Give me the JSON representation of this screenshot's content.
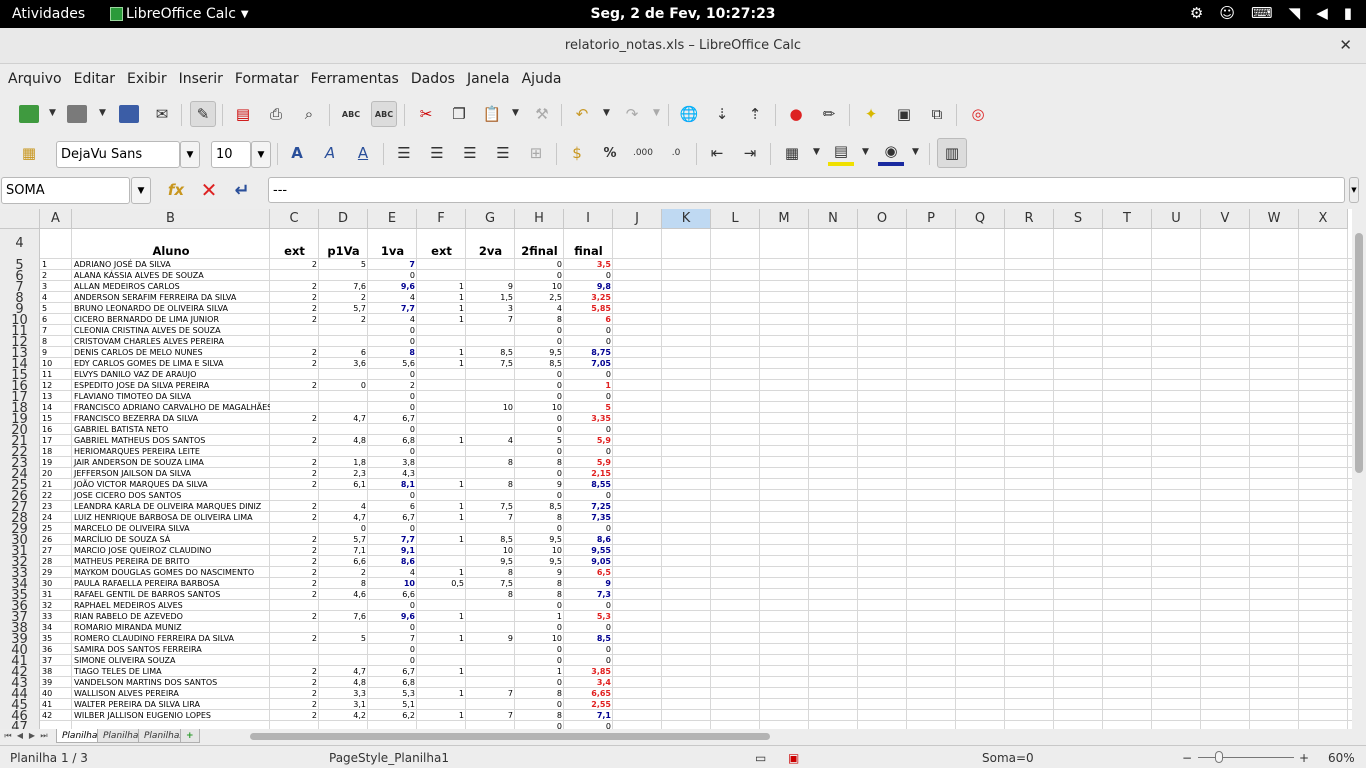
{
  "system": {
    "activities": "Atividades",
    "app_name": "LibreOffice Calc",
    "clock": "Seg,  2 de Fev, 10:27:23"
  },
  "window": {
    "title": "relatorio_notas.xls – LibreOffice Calc"
  },
  "menu": [
    "Arquivo",
    "Editar",
    "Exibir",
    "Inserir",
    "Formatar",
    "Ferramentas",
    "Dados",
    "Janela",
    "Ajuda"
  ],
  "toolbar": {
    "font_name": "DejaVu Sans",
    "font_size": "10"
  },
  "formula_bar": {
    "name_box": "SOMA",
    "content": "---"
  },
  "columns": [
    "A",
    "B",
    "C",
    "D",
    "E",
    "F",
    "G",
    "H",
    "I",
    "J",
    "K",
    "L",
    "M",
    "N",
    "O",
    "P",
    "Q",
    "R",
    "S",
    "T",
    "U",
    "V",
    "W",
    "X"
  ],
  "selected_column": "K",
  "header_row": {
    "row": "4",
    "cells": [
      "",
      "Aluno",
      "ext",
      "p1Va",
      "1va",
      "ext",
      "2va",
      "2final",
      "final"
    ]
  },
  "rows": [
    [
      "5",
      "1",
      "ADRIANO JOSÉ DA SILVA",
      "2",
      "5",
      "7",
      "",
      "",
      "0",
      "3,5",
      "b",
      "r"
    ],
    [
      "6",
      "2",
      "ALANA KÁSSIA ALVES DE SOUZA",
      "",
      "",
      "0",
      "",
      "",
      "0",
      "0",
      "",
      ""
    ],
    [
      "7",
      "3",
      "ALLAN MEDEIROS CARLOS",
      "2",
      "7,6",
      "9,6",
      "1",
      "9",
      "10",
      "9,8",
      "b",
      "b"
    ],
    [
      "8",
      "4",
      "ANDERSON SERAFIM FERREIRA DA SILVA",
      "2",
      "2",
      "4",
      "1",
      "1,5",
      "2,5",
      "3,25",
      "",
      "r"
    ],
    [
      "9",
      "5",
      "BRUNO LEONARDO DE OLIVEIRA SILVA",
      "2",
      "5,7",
      "7,7",
      "1",
      "3",
      "4",
      "5,85",
      "b",
      "r"
    ],
    [
      "10",
      "6",
      "CICERO BERNARDO DE LIMA JUNIOR",
      "2",
      "2",
      "4",
      "1",
      "7",
      "8",
      "6",
      "",
      "r"
    ],
    [
      "11",
      "7",
      "CLEONIA CRISTINA ALVES DE SOUZA",
      "",
      "",
      "0",
      "",
      "",
      "0",
      "0",
      "",
      ""
    ],
    [
      "12",
      "8",
      "CRISTOVAM CHARLES ALVES PEREIRA",
      "",
      "",
      "0",
      "",
      "",
      "0",
      "0",
      "",
      ""
    ],
    [
      "13",
      "9",
      "DENIS CARLOS DE MELO NUNES",
      "2",
      "6",
      "8",
      "1",
      "8,5",
      "9,5",
      "8,75",
      "b",
      "b"
    ],
    [
      "14",
      "10",
      "EDY CARLOS GOMES DE LIMA E SILVA",
      "2",
      "3,6",
      "5,6",
      "1",
      "7,5",
      "8,5",
      "7,05",
      "",
      "b"
    ],
    [
      "15",
      "11",
      "ELVYS DANILO VAZ DE ARAUJO",
      "",
      "",
      "0",
      "",
      "",
      "0",
      "0",
      "",
      ""
    ],
    [
      "16",
      "12",
      "ESPEDITO JOSE DA SILVA PEREIRA",
      "2",
      "0",
      "2",
      "",
      "",
      "0",
      "1",
      "",
      "r"
    ],
    [
      "17",
      "13",
      "FLAVIANO TIMOTEO DA SILVA",
      "",
      "",
      "0",
      "",
      "",
      "0",
      "0",
      "",
      ""
    ],
    [
      "18",
      "14",
      "FRANCISCO ADRIANO CARVALHO DE MAGALHÃES",
      "",
      "",
      "0",
      "",
      "10",
      "10",
      "5",
      "",
      "r"
    ],
    [
      "19",
      "15",
      "FRANCISCO BEZERRA DA SILVA",
      "2",
      "4,7",
      "6,7",
      "",
      "",
      "0",
      "3,35",
      "",
      "r"
    ],
    [
      "20",
      "16",
      "GABRIEL BATISTA NETO",
      "",
      "",
      "0",
      "",
      "",
      "0",
      "0",
      "",
      ""
    ],
    [
      "21",
      "17",
      "GABRIEL MATHEUS DOS SANTOS",
      "2",
      "4,8",
      "6,8",
      "1",
      "4",
      "5",
      "5,9",
      "",
      "r"
    ],
    [
      "22",
      "18",
      "HERIOMARQUES PEREIRA LEITE",
      "",
      "",
      "0",
      "",
      "",
      "0",
      "0",
      "",
      ""
    ],
    [
      "23",
      "19",
      "JAIR ANDERSON DE SOUZA LIMA",
      "2",
      "1,8",
      "3,8",
      "",
      "8",
      "8",
      "5,9",
      "",
      "r"
    ],
    [
      "24",
      "20",
      "JEFFERSON JAILSON DA SILVA",
      "2",
      "2,3",
      "4,3",
      "",
      "",
      "0",
      "2,15",
      "",
      "r"
    ],
    [
      "25",
      "21",
      "JOÃO VICTOR MARQUES DA SILVA",
      "2",
      "6,1",
      "8,1",
      "1",
      "8",
      "9",
      "8,55",
      "b",
      "b"
    ],
    [
      "26",
      "22",
      "JOSE CICERO DOS SANTOS",
      "",
      "",
      "0",
      "",
      "",
      "0",
      "0",
      "",
      ""
    ],
    [
      "27",
      "23",
      "LEANDRA KARLA DE OLIVEIRA MARQUES DINIZ",
      "2",
      "4",
      "6",
      "1",
      "7,5",
      "8,5",
      "7,25",
      "",
      "b"
    ],
    [
      "28",
      "24",
      "LUIZ HENRIQUE BARBOSA DE OLIVEIRA LIMA",
      "2",
      "4,7",
      "6,7",
      "1",
      "7",
      "8",
      "7,35",
      "",
      "b"
    ],
    [
      "29",
      "25",
      "MARCELO DE OLIVEIRA SILVA",
      "",
      "0",
      "0",
      "",
      "",
      "0",
      "0",
      "",
      ""
    ],
    [
      "30",
      "26",
      "MARCÍLIO DE SOUZA SÁ",
      "2",
      "5,7",
      "7,7",
      "1",
      "8,5",
      "9,5",
      "8,6",
      "b",
      "b"
    ],
    [
      "31",
      "27",
      "MARCIO JOSE QUEIROZ CLAUDINO",
      "2",
      "7,1",
      "9,1",
      "",
      "10",
      "10",
      "9,55",
      "b",
      "b"
    ],
    [
      "32",
      "28",
      "MATHEUS PEREIRA DE BRITO",
      "2",
      "6,6",
      "8,6",
      "",
      "9,5",
      "9,5",
      "9,05",
      "b",
      "b"
    ],
    [
      "33",
      "29",
      "MAYKOM DOUGLAS GOMES DO NASCIMENTO",
      "2",
      "2",
      "4",
      "1",
      "8",
      "9",
      "6,5",
      "",
      "r"
    ],
    [
      "34",
      "30",
      "PAULA RAFAELLA PEREIRA BARBOSA",
      "2",
      "8",
      "10",
      "0,5",
      "7,5",
      "8",
      "9",
      "b",
      "b"
    ],
    [
      "35",
      "31",
      "RAFAEL GENTIL DE BARROS SANTOS",
      "2",
      "4,6",
      "6,6",
      "",
      "8",
      "8",
      "7,3",
      "",
      "b"
    ],
    [
      "36",
      "32",
      "RAPHAEL MEDEIROS ALVES",
      "",
      "",
      "0",
      "",
      "",
      "0",
      "0",
      "",
      ""
    ],
    [
      "37",
      "33",
      "RIAN RABELO DE AZEVEDO",
      "2",
      "7,6",
      "9,6",
      "1",
      "",
      "1",
      "5,3",
      "b",
      "r"
    ],
    [
      "38",
      "34",
      "ROMARIO MIRANDA MUNIZ",
      "",
      "",
      "0",
      "",
      "",
      "0",
      "0",
      "",
      ""
    ],
    [
      "39",
      "35",
      "ROMERO CLAUDINO FERREIRA DA SILVA",
      "2",
      "5",
      "7",
      "1",
      "9",
      "10",
      "8,5",
      "",
      "b"
    ],
    [
      "40",
      "36",
      "SAMIRA DOS SANTOS FERREIRA",
      "",
      "",
      "0",
      "",
      "",
      "0",
      "0",
      "",
      ""
    ],
    [
      "41",
      "37",
      "SIMONE OLIVEIRA SOUZA",
      "",
      "",
      "0",
      "",
      "",
      "0",
      "0",
      "",
      ""
    ],
    [
      "42",
      "38",
      "TIAGO TELES DE LIMA",
      "2",
      "4,7",
      "6,7",
      "1",
      "",
      "1",
      "3,85",
      "",
      "r"
    ],
    [
      "43",
      "39",
      "VANDELSON MARTINS DOS SANTOS",
      "2",
      "4,8",
      "6,8",
      "",
      "",
      "0",
      "3,4",
      "",
      "r"
    ],
    [
      "44",
      "40",
      "WALLISON ALVES PEREIRA",
      "2",
      "3,3",
      "5,3",
      "1",
      "7",
      "8",
      "6,65",
      "",
      "r"
    ],
    [
      "45",
      "41",
      "WALTER PEREIRA DA SILVA LIRA",
      "2",
      "3,1",
      "5,1",
      "",
      "",
      "0",
      "2,55",
      "",
      "r"
    ],
    [
      "46",
      "42",
      "WILBER JALLISON EUGENIO LOPES",
      "2",
      "4,2",
      "6,2",
      "1",
      "7",
      "8",
      "7,1",
      "",
      "b"
    ],
    [
      "47",
      "",
      "",
      "",
      "",
      "",
      "",
      "",
      "0",
      "0",
      "",
      ""
    ]
  ],
  "sheets": [
    "Planilha1",
    "Planilha2",
    "Planilha3"
  ],
  "status": {
    "sheet": "Planilha 1 / 3",
    "page_style": "PageStyle_Planilha1",
    "sum": "Soma=0",
    "zoom": "60%"
  },
  "colors": {
    "blue_grade": "#000090",
    "red_grade": "#e02020",
    "selected_col": "#bfd9f2"
  }
}
